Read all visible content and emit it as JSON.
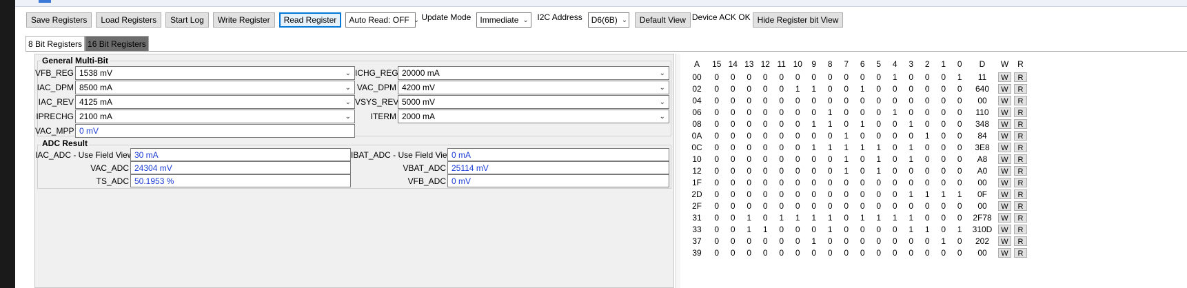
{
  "toolbar": {
    "save_registers": "Save Registers",
    "load_registers": "Load Registers",
    "start_log": "Start Log",
    "write_register": "Write Register",
    "read_register": "Read Register",
    "auto_read": "Auto Read: OFF",
    "update_mode_label": "Update Mode",
    "update_mode_value": "Immediate",
    "i2c_address_label": "I2C Address",
    "i2c_address_value": "D6(6B)",
    "default_view": "Default View",
    "device_ack": "Device ACK OK",
    "hide_register_bit_view": "Hide Register bit View"
  },
  "tabs": [
    "8 Bit Registers",
    "16 Bit Registers"
  ],
  "general_multibit": {
    "title": "General Multi-Bit",
    "fields": {
      "vfb_reg": {
        "label": "VFB_REG",
        "value": "1538 mV"
      },
      "iac_dpm": {
        "label": "IAC_DPM",
        "value": "8500 mA"
      },
      "iac_rev": {
        "label": "IAC_REV",
        "value": "4125 mA"
      },
      "iprechg": {
        "label": "IPRECHG",
        "value": "2100 mA"
      },
      "vac_mpp": {
        "label": "VAC_MPP",
        "value": "0 mV"
      },
      "ichg_reg": {
        "label": "ICHG_REG",
        "value": "20000 mA"
      },
      "vac_dpm": {
        "label": "VAC_DPM",
        "value": "4200 mV"
      },
      "vsys_rev": {
        "label": "VSYS_REV",
        "value": "5000 mV"
      },
      "iterm": {
        "label": "ITERM",
        "value": "2000 mA"
      }
    }
  },
  "adc_result": {
    "title": "ADC Result",
    "fields": {
      "iac_adc": {
        "label": "IAC_ADC - Use Field View",
        "value": "30 mA"
      },
      "vac_adc": {
        "label": "VAC_ADC",
        "value": "24304 mV"
      },
      "ts_adc": {
        "label": "TS_ADC",
        "value": "50.1953 %"
      },
      "ibat_adc": {
        "label": "IBAT_ADC - Use Field View",
        "value": "0 mA"
      },
      "vbat_adc": {
        "label": "VBAT_ADC",
        "value": "25114 mV"
      },
      "vfb_adc": {
        "label": "VFB_ADC",
        "value": "0 mV"
      }
    }
  },
  "register_table": {
    "headers": [
      "A",
      "15",
      "14",
      "13",
      "12",
      "11",
      "10",
      "9",
      "8",
      "7",
      "6",
      "5",
      "4",
      "3",
      "2",
      "1",
      "0",
      "D",
      "W",
      "R"
    ],
    "write_label": "W",
    "read_label": "R",
    "rows": [
      {
        "a": "00",
        "bits": [
          "0",
          "0",
          "0",
          "0",
          "0",
          "0",
          "0",
          "0",
          "0",
          "0",
          "0",
          "1",
          "0",
          "0",
          "0",
          "1"
        ],
        "d": "11"
      },
      {
        "a": "02",
        "bits": [
          "0",
          "0",
          "0",
          "0",
          "0",
          "1",
          "1",
          "0",
          "0",
          "1",
          "0",
          "0",
          "0",
          "0",
          "0",
          "0"
        ],
        "d": "640"
      },
      {
        "a": "04",
        "bits": [
          "0",
          "0",
          "0",
          "0",
          "0",
          "0",
          "0",
          "0",
          "0",
          "0",
          "0",
          "0",
          "0",
          "0",
          "0",
          "0"
        ],
        "d": "00"
      },
      {
        "a": "06",
        "bits": [
          "0",
          "0",
          "0",
          "0",
          "0",
          "0",
          "0",
          "1",
          "0",
          "0",
          "0",
          "1",
          "0",
          "0",
          "0",
          "0"
        ],
        "d": "110"
      },
      {
        "a": "08",
        "bits": [
          "0",
          "0",
          "0",
          "0",
          "0",
          "0",
          "1",
          "1",
          "0",
          "1",
          "0",
          "0",
          "1",
          "0",
          "0",
          "0"
        ],
        "d": "348"
      },
      {
        "a": "0A",
        "bits": [
          "0",
          "0",
          "0",
          "0",
          "0",
          "0",
          "0",
          "0",
          "1",
          "0",
          "0",
          "0",
          "0",
          "1",
          "0",
          "0"
        ],
        "d": "84"
      },
      {
        "a": "0C",
        "bits": [
          "0",
          "0",
          "0",
          "0",
          "0",
          "0",
          "1",
          "1",
          "1",
          "1",
          "1",
          "0",
          "1",
          "0",
          "0",
          "0"
        ],
        "d": "3E8"
      },
      {
        "a": "10",
        "bits": [
          "0",
          "0",
          "0",
          "0",
          "0",
          "0",
          "0",
          "0",
          "1",
          "0",
          "1",
          "0",
          "1",
          "0",
          "0",
          "0"
        ],
        "d": "A8"
      },
      {
        "a": "12",
        "bits": [
          "0",
          "0",
          "0",
          "0",
          "0",
          "0",
          "0",
          "0",
          "1",
          "0",
          "1",
          "0",
          "0",
          "0",
          "0",
          "0"
        ],
        "d": "A0"
      },
      {
        "a": "1F",
        "bits": [
          "0",
          "0",
          "0",
          "0",
          "0",
          "0",
          "0",
          "0",
          "0",
          "0",
          "0",
          "0",
          "0",
          "0",
          "0",
          "0"
        ],
        "d": "00"
      },
      {
        "a": "2D",
        "bits": [
          "0",
          "0",
          "0",
          "0",
          "0",
          "0",
          "0",
          "0",
          "0",
          "0",
          "0",
          "0",
          "1",
          "1",
          "1",
          "1"
        ],
        "d": "0F"
      },
      {
        "a": "2F",
        "bits": [
          "0",
          "0",
          "0",
          "0",
          "0",
          "0",
          "0",
          "0",
          "0",
          "0",
          "0",
          "0",
          "0",
          "0",
          "0",
          "0"
        ],
        "d": "00"
      },
      {
        "a": "31",
        "bits": [
          "0",
          "0",
          "1",
          "0",
          "1",
          "1",
          "1",
          "1",
          "0",
          "1",
          "1",
          "1",
          "1",
          "0",
          "0",
          "0"
        ],
        "d": "2F78"
      },
      {
        "a": "33",
        "bits": [
          "0",
          "0",
          "1",
          "1",
          "0",
          "0",
          "0",
          "1",
          "0",
          "0",
          "0",
          "0",
          "1",
          "1",
          "0",
          "1"
        ],
        "d": "310D"
      },
      {
        "a": "37",
        "bits": [
          "0",
          "0",
          "0",
          "0",
          "0",
          "0",
          "1",
          "0",
          "0",
          "0",
          "0",
          "0",
          "0",
          "0",
          "1",
          "0"
        ],
        "d": "202"
      },
      {
        "a": "39",
        "bits": [
          "0",
          "0",
          "0",
          "0",
          "0",
          "0",
          "0",
          "0",
          "0",
          "0",
          "0",
          "0",
          "0",
          "0",
          "0",
          "0"
        ],
        "d": "00"
      }
    ]
  }
}
